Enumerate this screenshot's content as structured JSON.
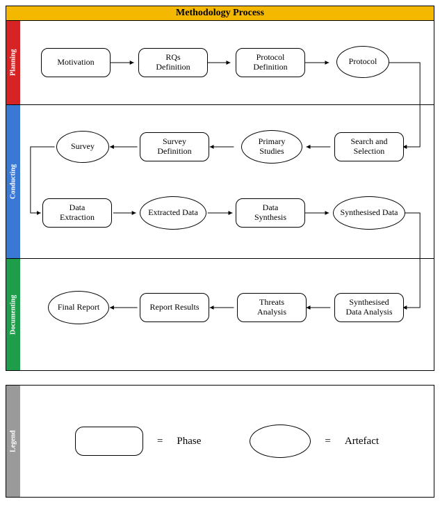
{
  "title": "Methodology Process",
  "sections": {
    "planning": {
      "label": "Planning",
      "nodes": {
        "motivation": "Motivation",
        "rqs": "RQs\nDefinition",
        "protocoldef": "Protocol\nDefinition",
        "protocol": "Protocol"
      }
    },
    "conducting": {
      "label": "Conducting",
      "nodes": {
        "search": "Search and\nSelection",
        "primary": "Primary\nStudies",
        "surveydef": "Survey\nDefinition",
        "survey": "Survey",
        "dataext": "Data\nExtraction",
        "extracted": "Extracted Data",
        "datasynth": "Data\nSynthesis",
        "synth": "Synthesised Data"
      }
    },
    "documenting": {
      "label": "Documenting",
      "nodes": {
        "synthanalysis": "Synthesised\nData Analysis",
        "threats": "Threats\nAnalysis",
        "report": "Report Results",
        "final": "Final Report"
      }
    }
  },
  "legend": {
    "label": "Legend",
    "phase": "Phase",
    "artefact": "Artefact",
    "equals": "="
  }
}
